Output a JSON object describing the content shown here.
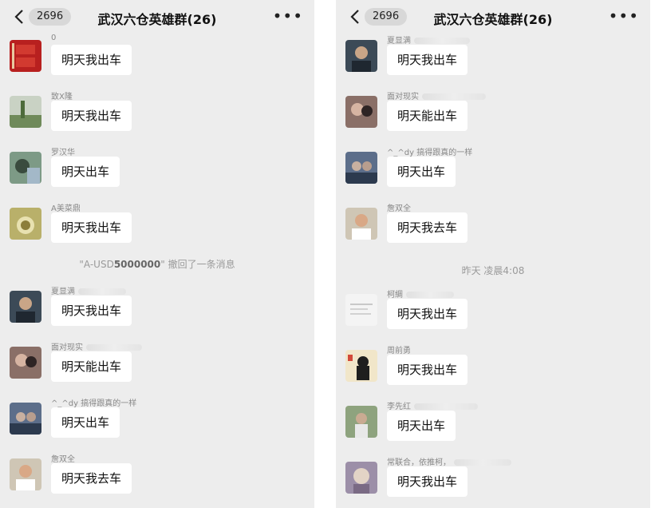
{
  "left": {
    "header": {
      "back_count": "2696",
      "title": "武汉六仓英雄群(26)",
      "more": "•••"
    },
    "messages": [
      {
        "sender": "0",
        "text": "明天我出车"
      },
      {
        "sender": "致Ⅹ隆",
        "text": "明天我出车"
      },
      {
        "sender": "罗汉华",
        "text": "明天出车"
      },
      {
        "sender": "A美菜鼎",
        "text": "明天我出车"
      }
    ],
    "recall": {
      "name_prefix": "\"A-USD",
      "name_highlight": "5000000",
      "name_suffix": "\"",
      "action": " 撤回了一条消息"
    },
    "messages2": [
      {
        "sender": "夏显满",
        "text": "明天我出车"
      },
      {
        "sender": "面对现实",
        "text": "明天能出车"
      },
      {
        "sender": "^_^dy 搞得跟真的一样",
        "text": "明天出车"
      },
      {
        "sender": "詹双全",
        "text": "明天我去车"
      }
    ]
  },
  "right": {
    "header": {
      "back_count": "2696",
      "title": "武汉六仓英雄群(26)",
      "more": "•••"
    },
    "messages": [
      {
        "sender": "夏显满",
        "text": "明天我出车"
      },
      {
        "sender": "面对现实",
        "text": "明天能出车"
      },
      {
        "sender": "^_^dy 搞得跟真的一样",
        "text": "明天出车"
      },
      {
        "sender": "詹双全",
        "text": "明天我去车"
      }
    ],
    "timestamp": "昨天 凌晨4:08",
    "messages2": [
      {
        "sender": "柯綢",
        "text": "明天我出车"
      },
      {
        "sender": "周前勇",
        "text": "明天我出车"
      },
      {
        "sender": "李先红",
        "text": "明天出车"
      },
      {
        "sender": "常联合，依推柯，",
        "text": "明天我出车"
      }
    ]
  }
}
